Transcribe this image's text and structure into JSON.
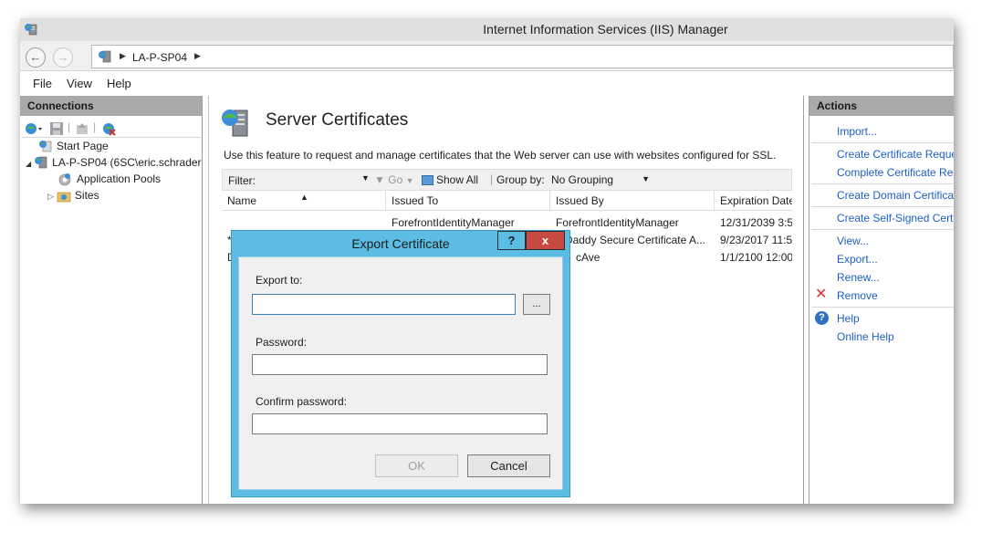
{
  "window": {
    "title": "Internet Information Services (IIS) Manager"
  },
  "address": {
    "path": "LA-P-SP04"
  },
  "menu": [
    "File",
    "View",
    "Help"
  ],
  "connections": {
    "header": "Connections",
    "tree": [
      {
        "label": "Start Page"
      },
      {
        "label": "LA-P-SP04 (6SC\\eric.schrader"
      },
      {
        "label": "Application Pools"
      },
      {
        "label": "Sites"
      }
    ]
  },
  "feature": {
    "title": "Server Certificates",
    "description": "Use this feature to request and manage certificates that the Web server can use with websites configured for SSL."
  },
  "filter": {
    "label": "Filter:",
    "go": "Go",
    "show_all": "Show All",
    "group_by_label": "Group by:",
    "group_by_value": "No Grouping"
  },
  "table": {
    "columns": [
      "Name",
      "Issued To",
      "Issued By",
      "Expiration Date"
    ],
    "rows": [
      {
        "name": "",
        "issued_to": "ForefrontIdentityManager",
        "issued_by": "ForefrontIdentityManager",
        "expiration": "12/31/2039 3:5!"
      },
      {
        "name": "*",
        "issued_to": "",
        "issued_by": "Daddy Secure Certificate A...",
        "expiration": "9/23/2017 11:5"
      },
      {
        "name": "D",
        "issued_to": "",
        "issued_by": "cAve",
        "expiration": "1/1/2100 12:00:"
      }
    ]
  },
  "actions": {
    "header": "Actions",
    "items": [
      "Import...",
      "Create Certificate Reque",
      "Complete Certificate Rec",
      "Create Domain Certificat",
      "Create Self-Signed Certifi",
      "View...",
      "Export...",
      "Renew...",
      "Remove",
      "Help",
      "Online Help"
    ]
  },
  "dialog": {
    "title": "Export Certificate",
    "help": "?",
    "close": "x",
    "export_to_label": "Export to:",
    "export_to_value": "",
    "browse": "...",
    "password_label": "Password:",
    "password_value": "",
    "confirm_label": "Confirm password:",
    "confirm_value": "",
    "ok": "OK",
    "cancel": "Cancel"
  },
  "colors": {
    "dialog_frame": "#5bbde3",
    "close_red": "#c74b40",
    "link_blue": "#1c5fc4",
    "pane_header": "#a9a9a9"
  }
}
